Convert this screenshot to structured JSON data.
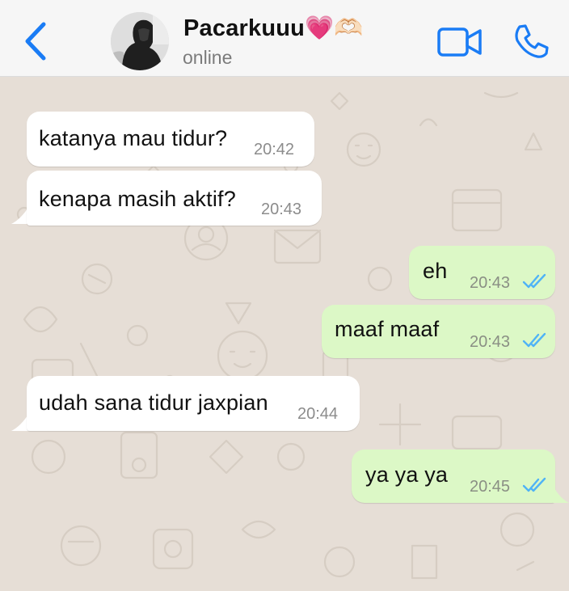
{
  "header": {
    "contact_name": "Pacarkuuu💗🫶🏻",
    "status": "online",
    "back_icon": "chevron-left-icon",
    "video_icon": "video-camera-icon",
    "call_icon": "phone-icon",
    "accent_color": "#1a7cf5"
  },
  "messages": [
    {
      "direction": "incoming",
      "text": "katanya mau tidur?",
      "time": "20:42"
    },
    {
      "direction": "incoming",
      "text": "kenapa masih aktif?",
      "time": "20:43"
    },
    {
      "direction": "outgoing",
      "text": "eh",
      "time": "20:43",
      "status": "read"
    },
    {
      "direction": "outgoing",
      "text": "maaf maaf",
      "time": "20:43",
      "status": "read"
    },
    {
      "direction": "incoming",
      "text": "udah sana tidur jaxpian",
      "time": "20:44"
    },
    {
      "direction": "outgoing",
      "text": "ya ya ya",
      "time": "20:45",
      "status": "read"
    }
  ],
  "colors": {
    "chat_background": "#e6ded6",
    "incoming_bubble": "#ffffff",
    "outgoing_bubble": "#dcf8c6",
    "read_ticks": "#4fb3f6"
  }
}
